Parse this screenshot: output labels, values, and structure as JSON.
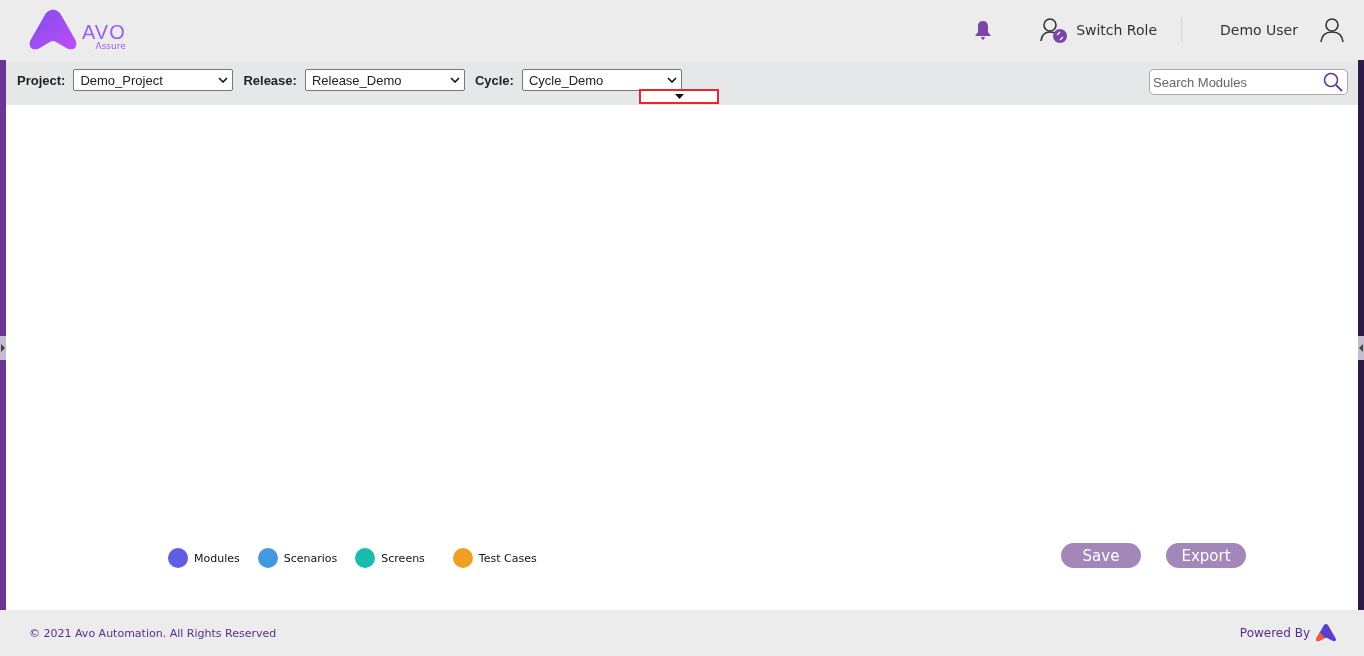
{
  "header": {
    "logo": {
      "title": "AVO",
      "subtitle": "Assure"
    },
    "switch_role": "Switch Role",
    "user": "Demo User"
  },
  "toolbar": {
    "selects": [
      {
        "label": "Project:",
        "value": "Demo_Project"
      },
      {
        "label": "Release:",
        "value": "Release_Demo"
      },
      {
        "label": "Cycle:",
        "value": "Cycle_Demo"
      }
    ],
    "search": {
      "placeholder": "Search Modules"
    }
  },
  "legend": [
    {
      "label": "Modules",
      "color": "#5f5ce6"
    },
    {
      "label": "Scenarios",
      "color": "#4299e1"
    },
    {
      "label": "Screens",
      "color": "#1abcad"
    },
    {
      "label": "Test Cases",
      "color": "#efa022"
    }
  ],
  "buttons": [
    {
      "label": "Save",
      "disabled": true
    },
    {
      "label": "Export",
      "disabled": true
    }
  ],
  "footer": {
    "copyright": "© 2021 Avo Automation. All Rights Reserved",
    "powered_by": "Powered By"
  }
}
